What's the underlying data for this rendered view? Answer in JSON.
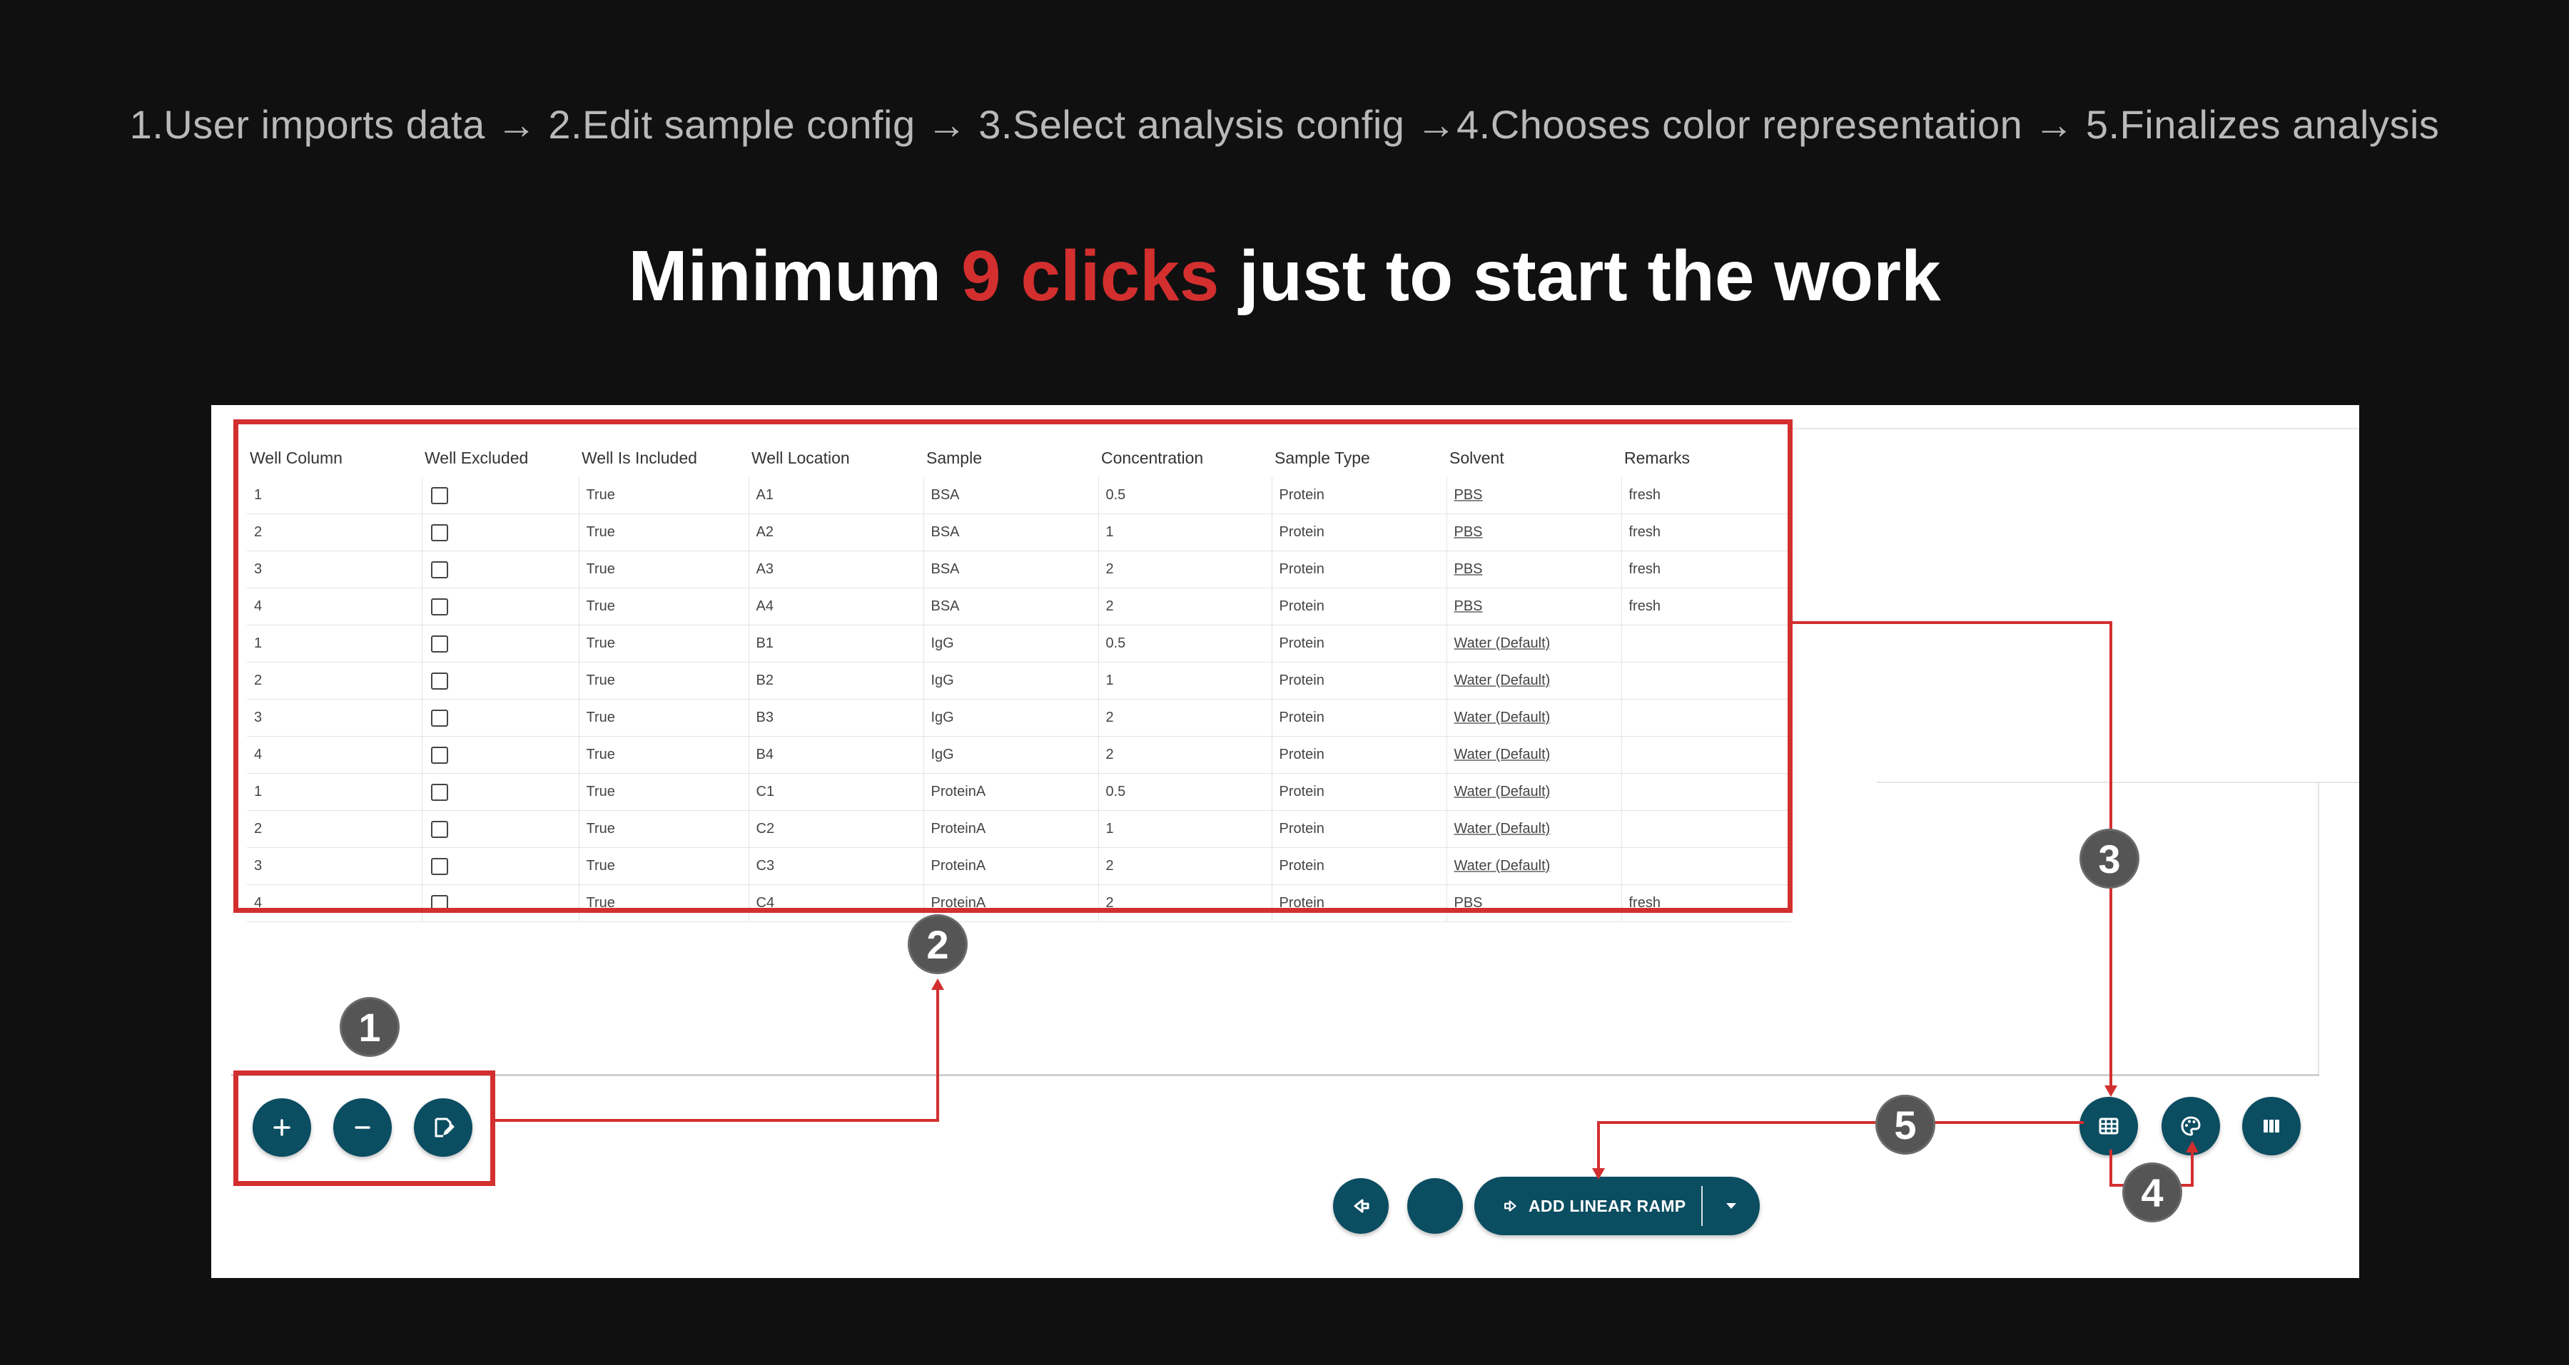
{
  "flow_text": "1.User imports data → 2.Edit sample config → 3.Select analysis config →4.Chooses color representation → 5.Finalizes analysis",
  "headline": {
    "before": "Minimum ",
    "accent": "9 clicks",
    "after": " just to start the work"
  },
  "colors": {
    "accent": "#d32f2f",
    "primary_button": "#0b4d61",
    "badge": "#555555",
    "background": "#101010"
  },
  "table": {
    "headers": [
      "Well Column",
      "Well Excluded",
      "Well Is Included",
      "Well Location",
      "Sample",
      "Concentration",
      "Sample Type",
      "Solvent",
      "Remarks"
    ],
    "rows": [
      {
        "col": "1",
        "excluded": false,
        "included": "True",
        "loc": "A1",
        "sample": "BSA",
        "conc": "0.5",
        "type": "Protein",
        "solvent": "PBS",
        "remarks": "fresh"
      },
      {
        "col": "2",
        "excluded": false,
        "included": "True",
        "loc": "A2",
        "sample": "BSA",
        "conc": "1",
        "type": "Protein",
        "solvent": "PBS",
        "remarks": "fresh"
      },
      {
        "col": "3",
        "excluded": false,
        "included": "True",
        "loc": "A3",
        "sample": "BSA",
        "conc": "2",
        "type": "Protein",
        "solvent": "PBS",
        "remarks": "fresh"
      },
      {
        "col": "4",
        "excluded": false,
        "included": "True",
        "loc": "A4",
        "sample": "BSA",
        "conc": "2",
        "type": "Protein",
        "solvent": "PBS",
        "remarks": "fresh"
      },
      {
        "col": "1",
        "excluded": false,
        "included": "True",
        "loc": "B1",
        "sample": "IgG",
        "conc": "0.5",
        "type": "Protein",
        "solvent": "Water (Default)",
        "remarks": ""
      },
      {
        "col": "2",
        "excluded": false,
        "included": "True",
        "loc": "B2",
        "sample": "IgG",
        "conc": "1",
        "type": "Protein",
        "solvent": "Water (Default)",
        "remarks": ""
      },
      {
        "col": "3",
        "excluded": false,
        "included": "True",
        "loc": "B3",
        "sample": "IgG",
        "conc": "2",
        "type": "Protein",
        "solvent": "Water (Default)",
        "remarks": ""
      },
      {
        "col": "4",
        "excluded": false,
        "included": "True",
        "loc": "B4",
        "sample": "IgG",
        "conc": "2",
        "type": "Protein",
        "solvent": "Water (Default)",
        "remarks": ""
      },
      {
        "col": "1",
        "excluded": false,
        "included": "True",
        "loc": "C1",
        "sample": "ProteinA",
        "conc": "0.5",
        "type": "Protein",
        "solvent": "Water (Default)",
        "remarks": ""
      },
      {
        "col": "2",
        "excluded": false,
        "included": "True",
        "loc": "C2",
        "sample": "ProteinA",
        "conc": "1",
        "type": "Protein",
        "solvent": "Water (Default)",
        "remarks": ""
      },
      {
        "col": "3",
        "excluded": false,
        "included": "True",
        "loc": "C3",
        "sample": "ProteinA",
        "conc": "2",
        "type": "Protein",
        "solvent": "Water (Default)",
        "remarks": ""
      },
      {
        "col": "4",
        "excluded": false,
        "included": "True",
        "loc": "C4",
        "sample": "ProteinA",
        "conc": "2",
        "type": "Protein",
        "solvent": "PBS",
        "remarks": "fresh"
      }
    ]
  },
  "toolbar_left": [
    {
      "name": "add-row-button",
      "icon": "plus-icon"
    },
    {
      "name": "remove-row-button",
      "icon": "minus-icon"
    },
    {
      "name": "save-edit-button",
      "icon": "save-edit-icon"
    }
  ],
  "toolbar_right": [
    {
      "name": "table-view-button",
      "icon": "table-grid-icon"
    },
    {
      "name": "color-palette-button",
      "icon": "palette-icon"
    },
    {
      "name": "columns-view-button",
      "icon": "columns-icon"
    }
  ],
  "bottom_actions": {
    "back_icon": "back-arrow-icon",
    "ramp_label": "ADD LINEAR RAMP",
    "ramp_icon": "arrow-right-icon",
    "dropdown_icon": "caret-down-icon"
  },
  "badges": [
    "1",
    "2",
    "3",
    "4",
    "5"
  ]
}
